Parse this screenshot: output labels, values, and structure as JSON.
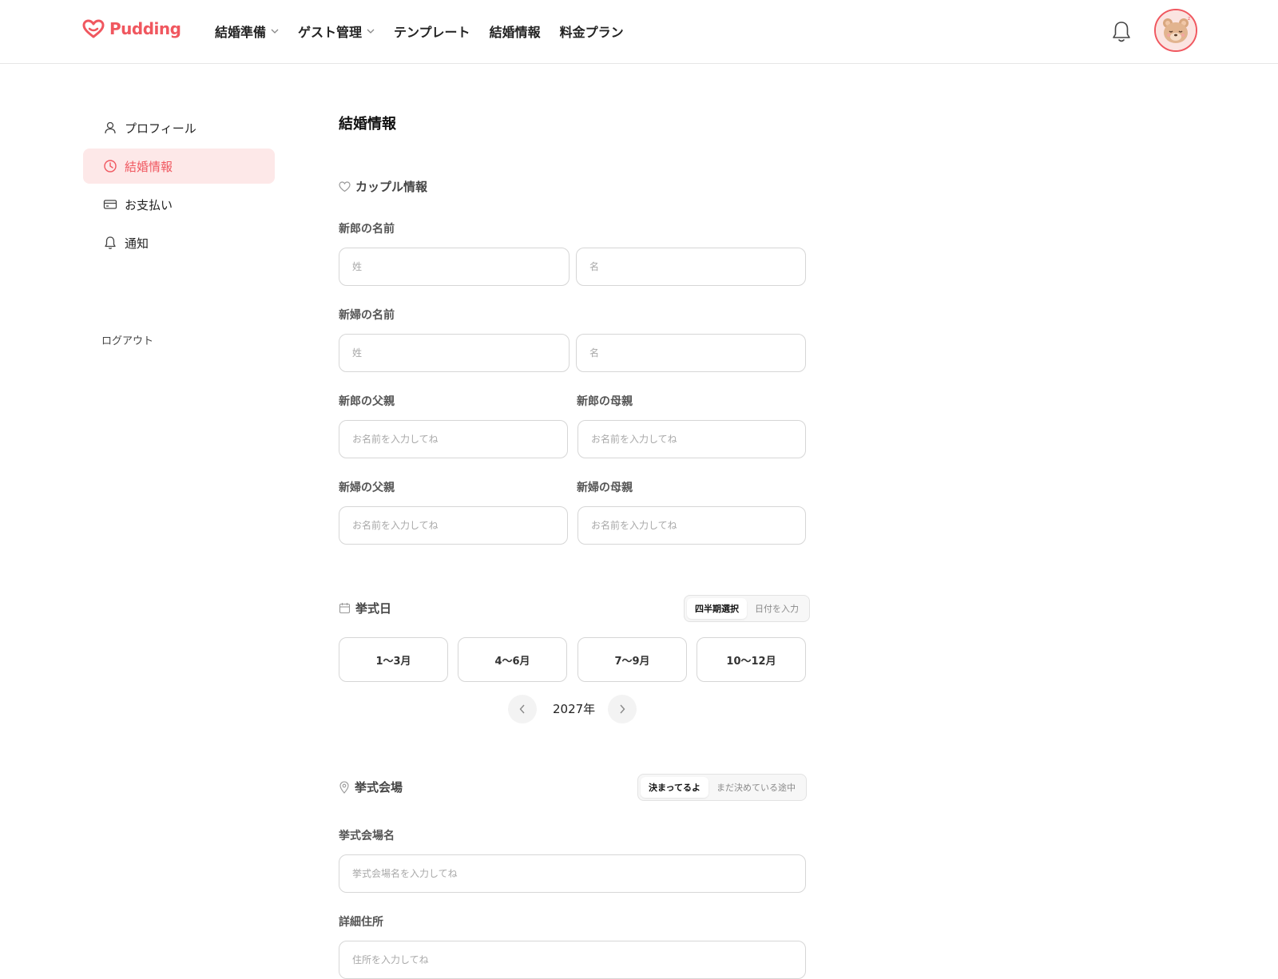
{
  "header": {
    "logo_text": "Pudding",
    "nav": [
      {
        "label": "結婚準備"
      },
      {
        "label": "ゲスト管理"
      },
      {
        "label": "テンプレート"
      },
      {
        "label": "結婚情報"
      },
      {
        "label": "料金プラン"
      }
    ]
  },
  "sidebar": {
    "items": [
      {
        "label": "プロフィール",
        "icon": "person-icon"
      },
      {
        "label": "結婚情報",
        "icon": "clock-icon",
        "active": true
      },
      {
        "label": "お支払い",
        "icon": "credit-card-icon"
      },
      {
        "label": "通知",
        "icon": "bell-icon"
      }
    ],
    "logout_label": "ログアウト"
  },
  "main": {
    "title": "結婚情報",
    "couple": {
      "heading": "カップル情報",
      "groom_name_label": "新郎の名前",
      "bride_name_label": "新婦の名前",
      "last_name_placeholder": "姓",
      "first_name_placeholder": "名",
      "groom_father_label": "新郎の父親",
      "groom_mother_label": "新郎の母親",
      "bride_father_label": "新婦の父親",
      "bride_mother_label": "新婦の母親",
      "parent_placeholder": "お名前を入力してね"
    },
    "ceremony_date": {
      "heading": "挙式日",
      "mode_options": [
        "四半期選択",
        "日付を入力"
      ],
      "selected_mode": "四半期選択",
      "quarters": [
        "1〜3月",
        "4〜6月",
        "7〜9月",
        "10〜12月"
      ],
      "year_label": "2027年"
    },
    "venue": {
      "heading": "挙式会場",
      "mode_options": [
        "決まってるよ",
        "まだ決めている途中"
      ],
      "selected_mode": "決まってるよ",
      "venue_name_label": "挙式会場名",
      "venue_name_placeholder": "挙式会場名を入力してね",
      "address_label": "詳細住所",
      "address_placeholder": "住所を入力してね"
    }
  },
  "colors": {
    "accent": "#f0575f",
    "active_bg": "#fde8e8",
    "border": "#d6d6d6"
  }
}
